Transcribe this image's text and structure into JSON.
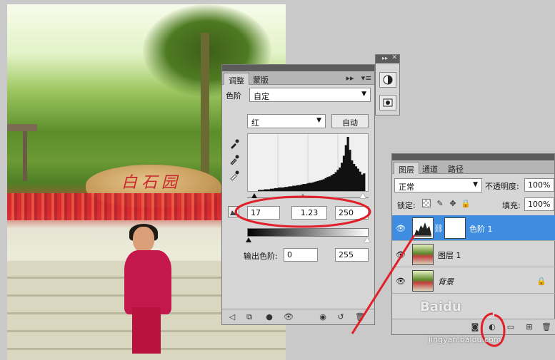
{
  "adjustments": {
    "tabs": [
      {
        "label": "调整"
      },
      {
        "label": "蒙版"
      }
    ],
    "levels_label": "色阶",
    "preset_value": "自定",
    "channel_value": "红",
    "auto_label": "自动",
    "input_black": "17",
    "input_gamma": "1.23",
    "input_white": "250",
    "output_label": "输出色阶:",
    "output_black": "0",
    "output_white": "255",
    "histogram": [
      2,
      2,
      2,
      3,
      3,
      3,
      4,
      4,
      5,
      5,
      6,
      6,
      6,
      7,
      7,
      8,
      8,
      9,
      9,
      10,
      10,
      11,
      12,
      12,
      13,
      14,
      14,
      15,
      16,
      17,
      18,
      19,
      20,
      22,
      24,
      25,
      27,
      29,
      32,
      36,
      40,
      48,
      60,
      78,
      92,
      70,
      52,
      46,
      42,
      38,
      33,
      28,
      30
    ]
  },
  "layers": {
    "tabs": [
      {
        "label": "图层"
      },
      {
        "label": "通道"
      },
      {
        "label": "路径"
      }
    ],
    "blend_mode": "正常",
    "opacity_label": "不透明度:",
    "opacity_value": "100%",
    "lock_label": "锁定:",
    "fill_label": "填充:",
    "fill_value": "100%",
    "rows": [
      {
        "name": "色阶 1"
      },
      {
        "name": "图层 1"
      },
      {
        "name": "背景"
      }
    ]
  },
  "photo": {
    "rock_text": "白石园"
  },
  "watermark": {
    "brand": "Baidu",
    "url": "jingyan.baidu.com"
  },
  "colors": {
    "selected_row": "#3f8de0",
    "annotation": "#e0202a"
  }
}
